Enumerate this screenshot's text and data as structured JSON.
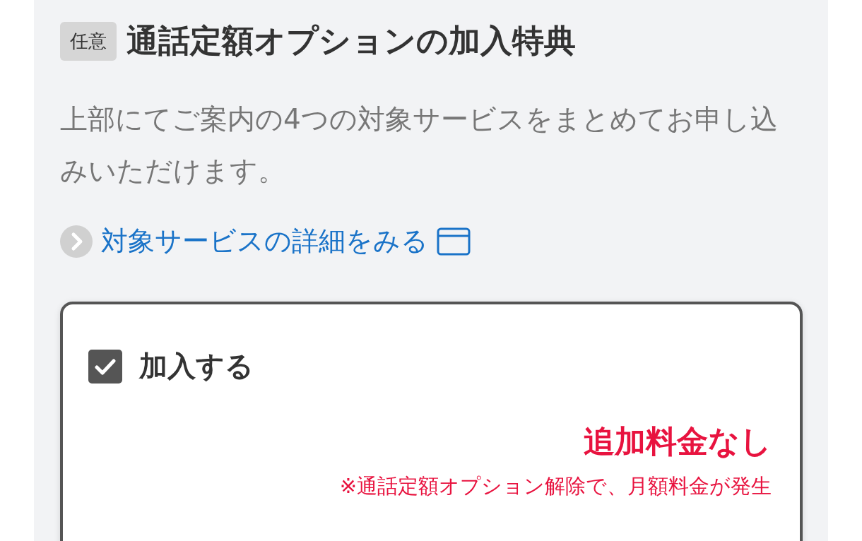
{
  "section": {
    "tag": "任意",
    "title": "通話定額オプションの加入特典",
    "description": "上部にてご案内の4つの対象サービスをまとめてお申し込みいただけます。",
    "link": {
      "label": "対象サービスの詳細をみる"
    },
    "option": {
      "label": "加入する",
      "checked": true,
      "price": "追加料金なし",
      "note": "※通話定額オプション解除で、月額料金が発生"
    }
  }
}
